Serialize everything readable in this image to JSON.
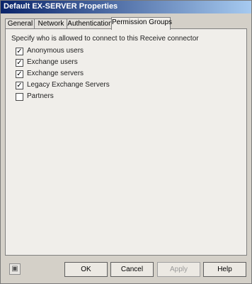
{
  "window": {
    "title": "Default EX-SERVER Properties"
  },
  "tabs": [
    {
      "label": "General",
      "active": false
    },
    {
      "label": "Network",
      "active": false
    },
    {
      "label": "Authentication",
      "active": false
    },
    {
      "label": "Permission Groups",
      "active": true
    }
  ],
  "panel": {
    "intro": "Specify who is allowed to connect to this Receive connector",
    "groups": [
      {
        "label": "Anonymous users",
        "checked": true
      },
      {
        "label": "Exchange users",
        "checked": true
      },
      {
        "label": "Exchange servers",
        "checked": true
      },
      {
        "label": "Legacy Exchange Servers",
        "checked": true
      },
      {
        "label": "Partners",
        "checked": false
      }
    ]
  },
  "footer": {
    "icon": "dialog-icon",
    "buttons": {
      "ok": "OK",
      "cancel": "Cancel",
      "apply": "Apply",
      "help": "Help"
    }
  }
}
